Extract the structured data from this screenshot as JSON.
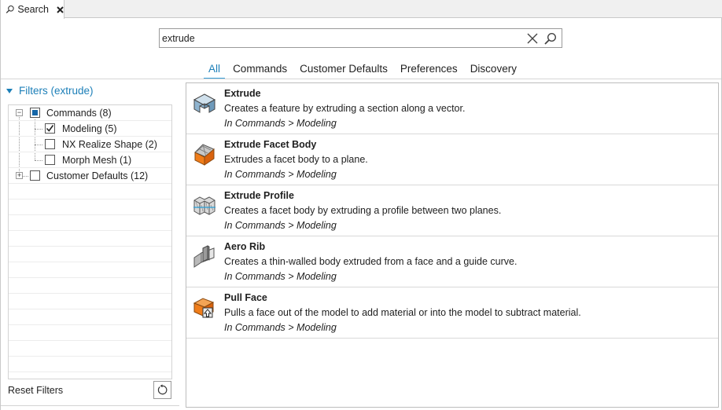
{
  "tab": {
    "label": "Search"
  },
  "search": {
    "value": "extrude",
    "placeholder": ""
  },
  "categories": [
    "All",
    "Commands",
    "Customer Defaults",
    "Preferences",
    "Discovery"
  ],
  "filters": {
    "title": "Filters (extrude)",
    "tree": [
      {
        "label": "Commands (8)",
        "state": "partial",
        "expander": "−"
      },
      {
        "label": "Modeling (5)",
        "state": "checked"
      },
      {
        "label": "NX Realize Shape (2)",
        "state": "unchecked"
      },
      {
        "label": "Morph Mesh (1)",
        "state": "unchecked"
      },
      {
        "label": "Customer Defaults (12)",
        "state": "unchecked",
        "expander": "+"
      }
    ],
    "reset_label": "Reset Filters"
  },
  "results": [
    {
      "name": "Extrude",
      "desc": "Creates a feature by extruding a section along a vector.",
      "path": "In Commands > Modeling",
      "icon": "extrude-icon"
    },
    {
      "name": "Extrude Facet Body",
      "desc": "Extrudes a facet body to a plane.",
      "path": "In Commands > Modeling",
      "icon": "extrude-facet-body-icon"
    },
    {
      "name": "Extrude Profile",
      "desc": "Creates a facet body by extruding a profile between two planes.",
      "path": "In Commands > Modeling",
      "icon": "extrude-profile-icon"
    },
    {
      "name": "Aero Rib",
      "desc": "Creates a thin-walled body extruded from a face and a guide curve.",
      "path": "In Commands > Modeling",
      "icon": "aero-rib-icon"
    },
    {
      "name": "Pull Face",
      "desc": "Pulls a face out of the model to add material or into the model to subtract material.",
      "path": "In Commands > Modeling",
      "icon": "pull-face-icon"
    }
  ],
  "colors": {
    "accent": "#1c7fb8",
    "tab_underline": "#3aa0d9",
    "orange": "#f07d1a"
  }
}
